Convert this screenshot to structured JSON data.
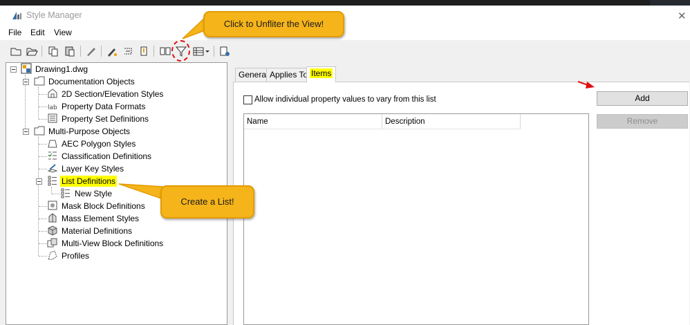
{
  "window": {
    "title": "Style Manager",
    "close_glyph": "✕"
  },
  "menu": [
    "File",
    "Edit",
    "View"
  ],
  "toolbar": {
    "icons": [
      "new-icon",
      "open-icon",
      "copy-icon",
      "paste-icon",
      "edit-style-icon",
      "purge-icon",
      "toggle-view-icon",
      "pen-icon",
      "set-from-icon",
      "compare-icon",
      "filter-icon",
      "view-options-icon",
      "help-icon"
    ]
  },
  "tree": {
    "root": "Drawing1.dwg",
    "documentation": {
      "label": "Documentation Objects",
      "children": [
        "2D Section/Elevation Styles",
        "Property Data Formats",
        "Property Set Definitions"
      ]
    },
    "multipurpose": {
      "label": "Multi-Purpose Objects",
      "children": [
        "AEC Polygon Styles",
        "Classification Definitions",
        "Layer Key Styles",
        "List Definitions",
        "Mask Block Definitions",
        "Mass Element Styles",
        "Material Definitions",
        "Multi-View Block Definitions",
        "Profiles"
      ]
    },
    "list_child": "New Style"
  },
  "tabs": [
    "General",
    "Applies To",
    "Items"
  ],
  "items_tab": {
    "checkbox_label": "Allow individual property values to vary from this list",
    "columns": [
      "Name",
      "Description"
    ],
    "add_label": "Add",
    "remove_label": "Remove"
  },
  "callouts": {
    "unfilter": "Click to Unfliter the View!",
    "create": "Create a List!"
  },
  "colors": {
    "callout_fill": "#f5b41a",
    "highlight": "#ffff00",
    "annotation_red": "#e01010"
  }
}
